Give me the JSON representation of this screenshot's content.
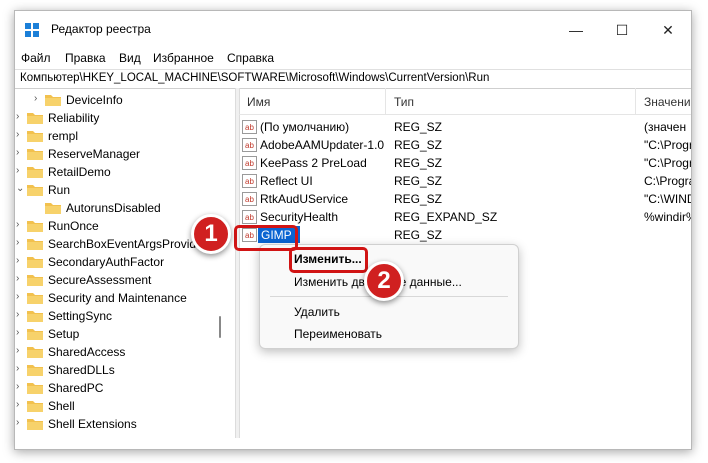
{
  "window": {
    "title": "Редактор реестра",
    "controls": {
      "minimize": "—",
      "maximize": "☐",
      "close": "✕"
    }
  },
  "menu": [
    "Файл",
    "Правка",
    "Вид",
    "Избранное",
    "Справка"
  ],
  "address": "Компьютер\\HKEY_LOCAL_MACHINE\\SOFTWARE\\Microsoft\\Windows\\CurrentVersion\\Run",
  "tree": [
    {
      "label": "DeviceInfo",
      "expander": "›",
      "indent": 1
    },
    {
      "label": "Reliability",
      "expander": "›",
      "indent": 0
    },
    {
      "label": "rempl",
      "expander": "›",
      "indent": 0
    },
    {
      "label": "ReserveManager",
      "expander": "›",
      "indent": 0
    },
    {
      "label": "RetailDemo",
      "expander": "›",
      "indent": 0
    },
    {
      "label": "Run",
      "expander": "⌄",
      "indent": 0,
      "selected": true
    },
    {
      "label": "AutorunsDisabled",
      "expander": "",
      "indent": 1
    },
    {
      "label": "RunOnce",
      "expander": "›",
      "indent": 0
    },
    {
      "label": "SearchBoxEventArgsProvid",
      "expander": "›",
      "indent": 0
    },
    {
      "label": "SecondaryAuthFactor",
      "expander": "›",
      "indent": 0
    },
    {
      "label": "SecureAssessment",
      "expander": "›",
      "indent": 0
    },
    {
      "label": "Security and Maintenance",
      "expander": "›",
      "indent": 0
    },
    {
      "label": "SettingSync",
      "expander": "›",
      "indent": 0
    },
    {
      "label": "Setup",
      "expander": "›",
      "indent": 0
    },
    {
      "label": "SharedAccess",
      "expander": "›",
      "indent": 0
    },
    {
      "label": "SharedDLLs",
      "expander": "›",
      "indent": 0
    },
    {
      "label": "SharedPC",
      "expander": "›",
      "indent": 0
    },
    {
      "label": "Shell",
      "expander": "›",
      "indent": 0
    },
    {
      "label": "Shell Extensions",
      "expander": "›",
      "indent": 0
    }
  ],
  "list": {
    "headers": [
      "Имя",
      "Тип",
      "Значение"
    ],
    "rows": [
      {
        "name": "(По умолчанию)",
        "type": "REG_SZ",
        "data": "(значен"
      },
      {
        "name": "AdobeAAMUpdater-1.0",
        "type": "REG_SZ",
        "data": "\"C:\\Progra"
      },
      {
        "name": "KeePass 2 PreLoad",
        "type": "REG_SZ",
        "data": "\"C:\\Progra"
      },
      {
        "name": "Reflect UI",
        "type": "REG_SZ",
        "data": "C:\\Progra"
      },
      {
        "name": "RtkAudUService",
        "type": "REG_SZ",
        "data": "\"C:\\WIND"
      },
      {
        "name": "SecurityHealth",
        "type": "REG_EXPAND_SZ",
        "data": "%windir%"
      },
      {
        "name": "GIMP",
        "type": "REG_SZ",
        "data": "",
        "selected": true
      }
    ],
    "icon_text": "ab"
  },
  "context_menu": {
    "items": [
      "Изменить...",
      "Изменить двоичные данные...",
      "Удалить",
      "Переименовать"
    ]
  },
  "callouts": [
    "1",
    "2"
  ],
  "colors": {
    "accent": "#0a64d2",
    "callout": "#d02020",
    "folder": "#f2c14e"
  }
}
